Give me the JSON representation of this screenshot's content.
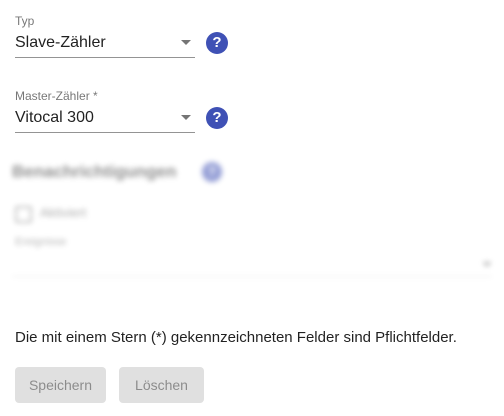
{
  "form": {
    "typ": {
      "label": "Typ",
      "value": "Slave-Zähler"
    },
    "master": {
      "label": "Master-Zähler *",
      "value": "Vitocal 300"
    },
    "help_icon_glyph": "?",
    "accent_color": "#3f51b5"
  },
  "notifications": {
    "heading": "Benachrichtigungen",
    "checkbox_label": "Aktiviert",
    "events_label": "Ereignisse"
  },
  "footer": {
    "required_note": "Die mit einem Stern (*) gekennzeichneten Felder sind Pflichtfelder.",
    "save_label": "Speichern",
    "delete_label": "Löschen"
  },
  "icons": [
    "help-icon",
    "dropdown-arrow-icon",
    "checkbox-icon"
  ]
}
